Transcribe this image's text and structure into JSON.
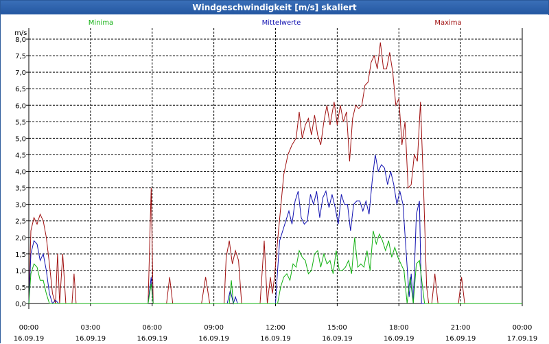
{
  "window": {
    "title": "Windgeschwindigkeit [m/s] skaliert"
  },
  "chart_data": {
    "type": "line",
    "title": "Windgeschwindigkeit [m/s] skaliert",
    "ylabel": "m/s",
    "ylim": [
      0,
      8
    ],
    "y_ticks": [
      "0,0",
      "0,5",
      "1,0",
      "1,5",
      "2,0",
      "2,5",
      "3,0",
      "3,5",
      "4,0",
      "4,5",
      "5,0",
      "5,5",
      "6,0",
      "6,5",
      "7,0",
      "7,5",
      "8,0"
    ],
    "xlim_hours": [
      0,
      24
    ],
    "x_ticks": [
      {
        "time": "00:00",
        "date": "16.09.19"
      },
      {
        "time": "03:00",
        "date": "16.09.19"
      },
      {
        "time": "06:00",
        "date": "16.09.19"
      },
      {
        "time": "09:00",
        "date": "16.09.19"
      },
      {
        "time": "12:00",
        "date": "16.09.19"
      },
      {
        "time": "15:00",
        "date": "16.09.19"
      },
      {
        "time": "18:00",
        "date": "16.09.19"
      },
      {
        "time": "21:00",
        "date": "16.09.19"
      },
      {
        "time": "00:00",
        "date": "17.09.19"
      }
    ],
    "grid": true,
    "legend_position": "top",
    "series": [
      {
        "name": "Maxima",
        "color": "#a01010",
        "points": [
          [
            0.0,
            0.0
          ],
          [
            0.1,
            2.2
          ],
          [
            0.25,
            2.6
          ],
          [
            0.4,
            2.4
          ],
          [
            0.55,
            2.7
          ],
          [
            0.7,
            2.5
          ],
          [
            0.85,
            2.0
          ],
          [
            1.0,
            1.2
          ],
          [
            1.15,
            0.3
          ],
          [
            1.3,
            0.0
          ],
          [
            1.4,
            1.5
          ],
          [
            1.5,
            0.0
          ],
          [
            1.65,
            1.5
          ],
          [
            1.8,
            0.0
          ],
          [
            2.1,
            0.0
          ],
          [
            2.2,
            0.9
          ],
          [
            2.3,
            0.0
          ],
          [
            5.8,
            0.0
          ],
          [
            5.95,
            3.5
          ],
          [
            6.05,
            0.0
          ],
          [
            6.7,
            0.0
          ],
          [
            6.85,
            0.8
          ],
          [
            7.0,
            0.0
          ],
          [
            8.4,
            0.0
          ],
          [
            8.6,
            0.8
          ],
          [
            8.8,
            0.0
          ],
          [
            9.5,
            0.0
          ],
          [
            9.6,
            1.4
          ],
          [
            9.75,
            1.9
          ],
          [
            9.9,
            1.2
          ],
          [
            10.05,
            1.6
          ],
          [
            10.2,
            1.3
          ],
          [
            10.35,
            0.0
          ],
          [
            11.25,
            0.0
          ],
          [
            11.45,
            1.9
          ],
          [
            11.6,
            0.0
          ],
          [
            11.75,
            0.8
          ],
          [
            11.85,
            0.3
          ],
          [
            11.95,
            0.8
          ],
          [
            12.1,
            1.9
          ],
          [
            12.25,
            2.9
          ],
          [
            12.4,
            3.9
          ],
          [
            12.6,
            4.5
          ],
          [
            12.8,
            4.8
          ],
          [
            13.0,
            5.0
          ],
          [
            13.15,
            5.8
          ],
          [
            13.3,
            5.0
          ],
          [
            13.45,
            5.4
          ],
          [
            13.6,
            5.6
          ],
          [
            13.75,
            5.1
          ],
          [
            13.9,
            5.7
          ],
          [
            14.05,
            5.1
          ],
          [
            14.2,
            4.8
          ],
          [
            14.35,
            5.5
          ],
          [
            14.5,
            6.0
          ],
          [
            14.65,
            5.4
          ],
          [
            14.85,
            6.1
          ],
          [
            15.0,
            5.4
          ],
          [
            15.15,
            6.0
          ],
          [
            15.3,
            5.5
          ],
          [
            15.45,
            5.8
          ],
          [
            15.6,
            4.3
          ],
          [
            15.75,
            5.6
          ],
          [
            15.9,
            6.0
          ],
          [
            16.05,
            5.9
          ],
          [
            16.2,
            6.0
          ],
          [
            16.35,
            6.6
          ],
          [
            16.5,
            6.7
          ],
          [
            16.65,
            7.3
          ],
          [
            16.8,
            7.5
          ],
          [
            16.95,
            7.1
          ],
          [
            17.1,
            7.9
          ],
          [
            17.25,
            7.1
          ],
          [
            17.4,
            7.1
          ],
          [
            17.55,
            7.6
          ],
          [
            17.7,
            7.0
          ],
          [
            17.85,
            6.0
          ],
          [
            18.0,
            6.2
          ],
          [
            18.15,
            4.8
          ],
          [
            18.3,
            5.5
          ],
          [
            18.45,
            3.5
          ],
          [
            18.6,
            3.6
          ],
          [
            18.75,
            4.5
          ],
          [
            18.9,
            4.3
          ],
          [
            19.05,
            6.1
          ],
          [
            19.2,
            3.5
          ],
          [
            19.35,
            0.5
          ],
          [
            19.45,
            0.0
          ],
          [
            19.6,
            0.0
          ],
          [
            19.75,
            0.9
          ],
          [
            19.9,
            0.0
          ],
          [
            20.9,
            0.0
          ],
          [
            21.05,
            0.8
          ],
          [
            21.2,
            0.0
          ],
          [
            24.0,
            0.0
          ]
        ]
      },
      {
        "name": "Mittelwerte",
        "color": "#1010b0",
        "points": [
          [
            0.0,
            0.0
          ],
          [
            0.1,
            1.5
          ],
          [
            0.25,
            1.9
          ],
          [
            0.4,
            1.8
          ],
          [
            0.55,
            1.3
          ],
          [
            0.7,
            1.5
          ],
          [
            0.85,
            1.0
          ],
          [
            1.0,
            0.3
          ],
          [
            1.15,
            0.0
          ],
          [
            1.3,
            0.1
          ],
          [
            1.45,
            0.0
          ],
          [
            5.8,
            0.0
          ],
          [
            5.95,
            0.8
          ],
          [
            6.05,
            0.0
          ],
          [
            9.65,
            0.0
          ],
          [
            9.8,
            0.4
          ],
          [
            9.95,
            0.0
          ],
          [
            10.05,
            0.2
          ],
          [
            10.15,
            0.0
          ],
          [
            12.0,
            0.0
          ],
          [
            12.1,
            1.0
          ],
          [
            12.2,
            1.9
          ],
          [
            12.35,
            2.2
          ],
          [
            12.5,
            2.5
          ],
          [
            12.65,
            2.8
          ],
          [
            12.8,
            2.4
          ],
          [
            12.95,
            3.1
          ],
          [
            13.1,
            3.4
          ],
          [
            13.25,
            2.6
          ],
          [
            13.4,
            2.4
          ],
          [
            13.55,
            2.5
          ],
          [
            13.7,
            3.3
          ],
          [
            13.85,
            3.0
          ],
          [
            14.0,
            3.4
          ],
          [
            14.15,
            2.6
          ],
          [
            14.3,
            3.2
          ],
          [
            14.45,
            3.4
          ],
          [
            14.6,
            2.9
          ],
          [
            14.75,
            3.3
          ],
          [
            14.9,
            2.9
          ],
          [
            15.05,
            2.4
          ],
          [
            15.2,
            3.3
          ],
          [
            15.35,
            3.0
          ],
          [
            15.5,
            3.0
          ],
          [
            15.65,
            2.2
          ],
          [
            15.8,
            3.0
          ],
          [
            15.95,
            3.1
          ],
          [
            16.1,
            3.1
          ],
          [
            16.25,
            2.8
          ],
          [
            16.4,
            3.1
          ],
          [
            16.55,
            2.7
          ],
          [
            16.7,
            3.7
          ],
          [
            16.85,
            4.5
          ],
          [
            17.0,
            4.0
          ],
          [
            17.15,
            4.2
          ],
          [
            17.3,
            4.1
          ],
          [
            17.45,
            3.6
          ],
          [
            17.6,
            4.0
          ],
          [
            17.75,
            3.6
          ],
          [
            17.9,
            3.0
          ],
          [
            18.05,
            3.4
          ],
          [
            18.2,
            3.0
          ],
          [
            18.35,
            1.6
          ],
          [
            18.5,
            0.2
          ],
          [
            18.6,
            0.9
          ],
          [
            18.7,
            0.0
          ],
          [
            18.85,
            2.7
          ],
          [
            19.0,
            3.1
          ],
          [
            19.1,
            0.0
          ],
          [
            24.0,
            0.0
          ]
        ]
      },
      {
        "name": "Minima",
        "color": "#10b010",
        "points": [
          [
            0.0,
            0.0
          ],
          [
            0.1,
            0.9
          ],
          [
            0.25,
            1.2
          ],
          [
            0.4,
            1.1
          ],
          [
            0.55,
            0.7
          ],
          [
            0.7,
            0.7
          ],
          [
            0.85,
            0.3
          ],
          [
            1.0,
            0.0
          ],
          [
            5.8,
            0.0
          ],
          [
            5.95,
            0.6
          ],
          [
            6.05,
            0.0
          ],
          [
            9.75,
            0.0
          ],
          [
            9.85,
            0.7
          ],
          [
            9.95,
            0.0
          ],
          [
            12.1,
            0.0
          ],
          [
            12.25,
            0.5
          ],
          [
            12.4,
            0.8
          ],
          [
            12.55,
            0.9
          ],
          [
            12.7,
            0.7
          ],
          [
            12.85,
            1.2
          ],
          [
            13.0,
            1.1
          ],
          [
            13.15,
            1.6
          ],
          [
            13.3,
            1.4
          ],
          [
            13.45,
            1.3
          ],
          [
            13.6,
            0.9
          ],
          [
            13.75,
            1.0
          ],
          [
            13.9,
            1.5
          ],
          [
            14.05,
            1.6
          ],
          [
            14.2,
            1.1
          ],
          [
            14.35,
            1.5
          ],
          [
            14.5,
            1.2
          ],
          [
            14.65,
            1.3
          ],
          [
            14.8,
            0.9
          ],
          [
            14.95,
            1.6
          ],
          [
            15.1,
            1.0
          ],
          [
            15.25,
            1.0
          ],
          [
            15.4,
            1.1
          ],
          [
            15.55,
            1.3
          ],
          [
            15.7,
            0.9
          ],
          [
            15.85,
            2.0
          ],
          [
            16.0,
            1.1
          ],
          [
            16.15,
            1.2
          ],
          [
            16.3,
            1.1
          ],
          [
            16.45,
            1.6
          ],
          [
            16.6,
            1.0
          ],
          [
            16.75,
            2.2
          ],
          [
            16.9,
            1.8
          ],
          [
            17.05,
            2.1
          ],
          [
            17.2,
            1.9
          ],
          [
            17.35,
            1.6
          ],
          [
            17.5,
            1.9
          ],
          [
            17.65,
            1.4
          ],
          [
            17.8,
            1.7
          ],
          [
            17.95,
            1.4
          ],
          [
            18.1,
            1.2
          ],
          [
            18.25,
            1.0
          ],
          [
            18.4,
            0.0
          ],
          [
            18.55,
            0.8
          ],
          [
            18.7,
            0.0
          ],
          [
            18.85,
            1.2
          ],
          [
            19.0,
            1.3
          ],
          [
            19.15,
            0.5
          ],
          [
            19.25,
            0.0
          ],
          [
            24.0,
            0.0
          ]
        ]
      }
    ]
  }
}
